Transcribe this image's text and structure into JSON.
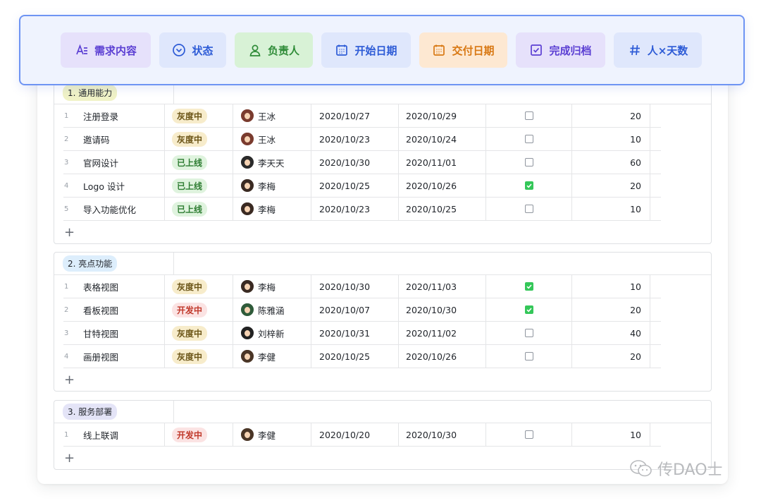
{
  "fields": [
    {
      "label": "需求内容",
      "icon": "text-icon",
      "color": "purple"
    },
    {
      "label": "状态",
      "icon": "chevron-circle-icon",
      "color": "blue"
    },
    {
      "label": "负责人",
      "icon": "person-icon",
      "color": "green"
    },
    {
      "label": "开始日期",
      "icon": "calendar-icon",
      "color": "blue"
    },
    {
      "label": "交付日期",
      "icon": "calendar-icon",
      "color": "orange"
    },
    {
      "label": "完成归档",
      "icon": "checkbox-icon",
      "color": "purple"
    },
    {
      "label": "人×天数",
      "icon": "hash-icon",
      "color": "blue"
    }
  ],
  "groups": [
    {
      "title": "1. 通用能力",
      "tag_color": "#f0f2c6",
      "rows": [
        {
          "num": "1",
          "name": "注册登录",
          "status": "灰度中",
          "status_color": "grey",
          "owner": "王冰",
          "avatar_hair": "#7a3b2e",
          "start": "2020/10/27",
          "end": "2020/10/29",
          "done": false,
          "days": "20"
        },
        {
          "num": "2",
          "name": "邀请码",
          "status": "灰度中",
          "status_color": "grey",
          "owner": "王冰",
          "avatar_hair": "#7a3b2e",
          "start": "2020/10/23",
          "end": "2020/10/24",
          "done": false,
          "days": "10"
        },
        {
          "num": "3",
          "name": "官网设计",
          "status": "已上线",
          "status_color": "green",
          "owner": "李天天",
          "avatar_hair": "#2b2b2b",
          "start": "2020/10/30",
          "end": "2020/11/01",
          "done": false,
          "days": "60"
        },
        {
          "num": "4",
          "name": "Logo 设计",
          "status": "已上线",
          "status_color": "green",
          "owner": "李梅",
          "avatar_hair": "#3a2a22",
          "start": "2020/10/25",
          "end": "2020/10/26",
          "done": true,
          "days": "20"
        },
        {
          "num": "5",
          "name": "导入功能优化",
          "status": "已上线",
          "status_color": "green",
          "owner": "李梅",
          "avatar_hair": "#3a2a22",
          "start": "2020/10/23",
          "end": "2020/10/25",
          "done": false,
          "days": "10"
        }
      ]
    },
    {
      "title": "2. 亮点功能",
      "tag_color": "#ddeefc",
      "rows": [
        {
          "num": "1",
          "name": "表格视图",
          "status": "灰度中",
          "status_color": "grey",
          "owner": "李梅",
          "avatar_hair": "#3a2a22",
          "start": "2020/10/30",
          "end": "2020/11/03",
          "done": true,
          "days": "10"
        },
        {
          "num": "2",
          "name": "看板视图",
          "status": "开发中",
          "status_color": "red",
          "owner": "陈雅涵",
          "avatar_hair": "#2f5b3a",
          "start": "2020/10/07",
          "end": "2020/10/30",
          "done": true,
          "days": "20"
        },
        {
          "num": "3",
          "name": "甘特视图",
          "status": "灰度中",
          "status_color": "grey",
          "owner": "刘梓新",
          "avatar_hair": "#222222",
          "start": "2020/10/31",
          "end": "2020/11/02",
          "done": false,
          "days": "40"
        },
        {
          "num": "4",
          "name": "画册视图",
          "status": "灰度中",
          "status_color": "grey",
          "owner": "李健",
          "avatar_hair": "#4a3526",
          "start": "2020/10/25",
          "end": "2020/10/26",
          "done": false,
          "days": "20"
        }
      ]
    },
    {
      "title": "3. 服务部署",
      "tag_color": "#e4e4f7",
      "rows": [
        {
          "num": "1",
          "name": "线上联调",
          "status": "开发中",
          "status_color": "red",
          "owner": "李健",
          "avatar_hair": "#4a3526",
          "start": "2020/10/20",
          "end": "2020/10/30",
          "done": false,
          "days": "10"
        }
      ]
    }
  ],
  "add_label": "+",
  "watermark": "传DAO士"
}
